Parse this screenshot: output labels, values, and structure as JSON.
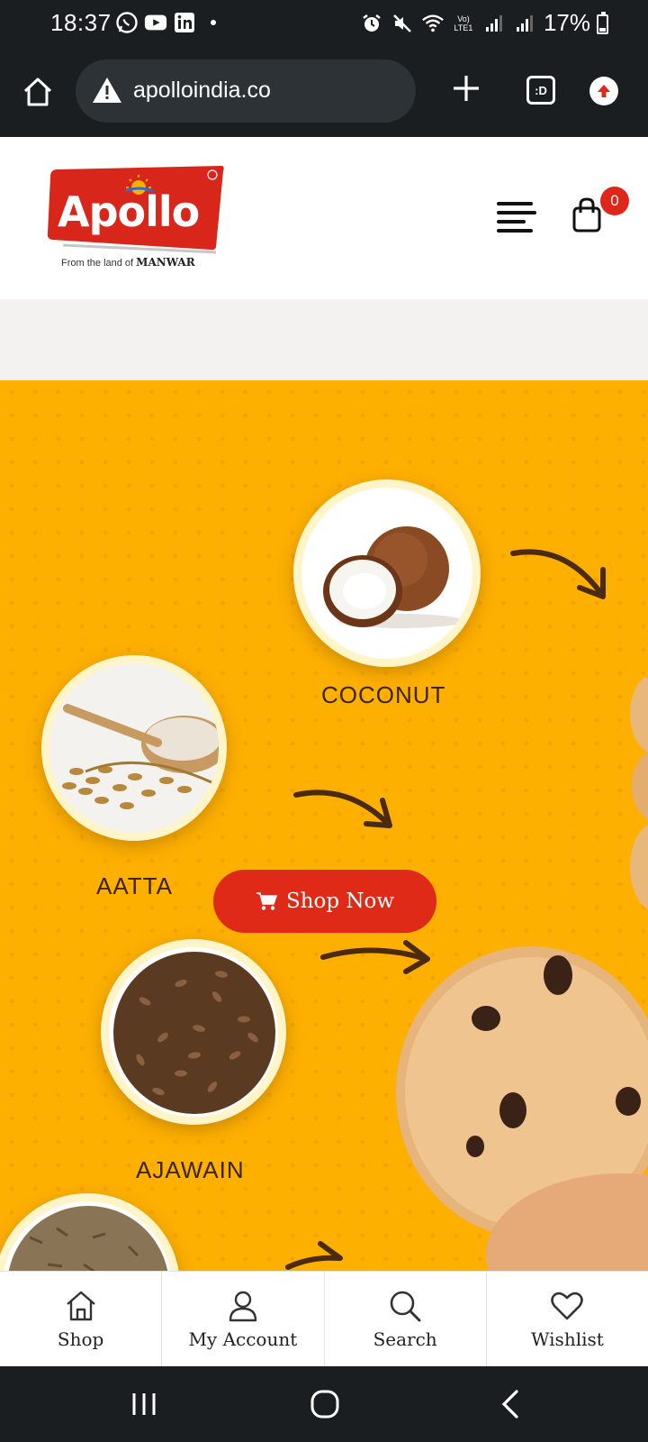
{
  "status_bar": {
    "time": "18:37",
    "network_label": "Vo) LTE1",
    "battery": "17%"
  },
  "browser": {
    "url": "apolloindia.co",
    "tabs_label": ":D"
  },
  "header": {
    "brand": "Apollo",
    "tagline_prefix": "From the land of",
    "tagline_place": "MANWAR",
    "cart_count": "0"
  },
  "hero": {
    "ingredients": [
      {
        "label": "COCONUT"
      },
      {
        "label": "AATTA"
      },
      {
        "label": "AJAWAIN"
      }
    ],
    "cta_label": "Shop Now"
  },
  "bottom_nav": {
    "items": [
      {
        "label": "Shop",
        "icon": "home-icon"
      },
      {
        "label": "My Account",
        "icon": "user-icon"
      },
      {
        "label": "Search",
        "icon": "search-icon"
      },
      {
        "label": "Wishlist",
        "icon": "heart-icon"
      }
    ]
  },
  "colors": {
    "hero_bg": "#fdb000",
    "cta_bg": "#df2a17",
    "brand_red": "#e0261b"
  }
}
